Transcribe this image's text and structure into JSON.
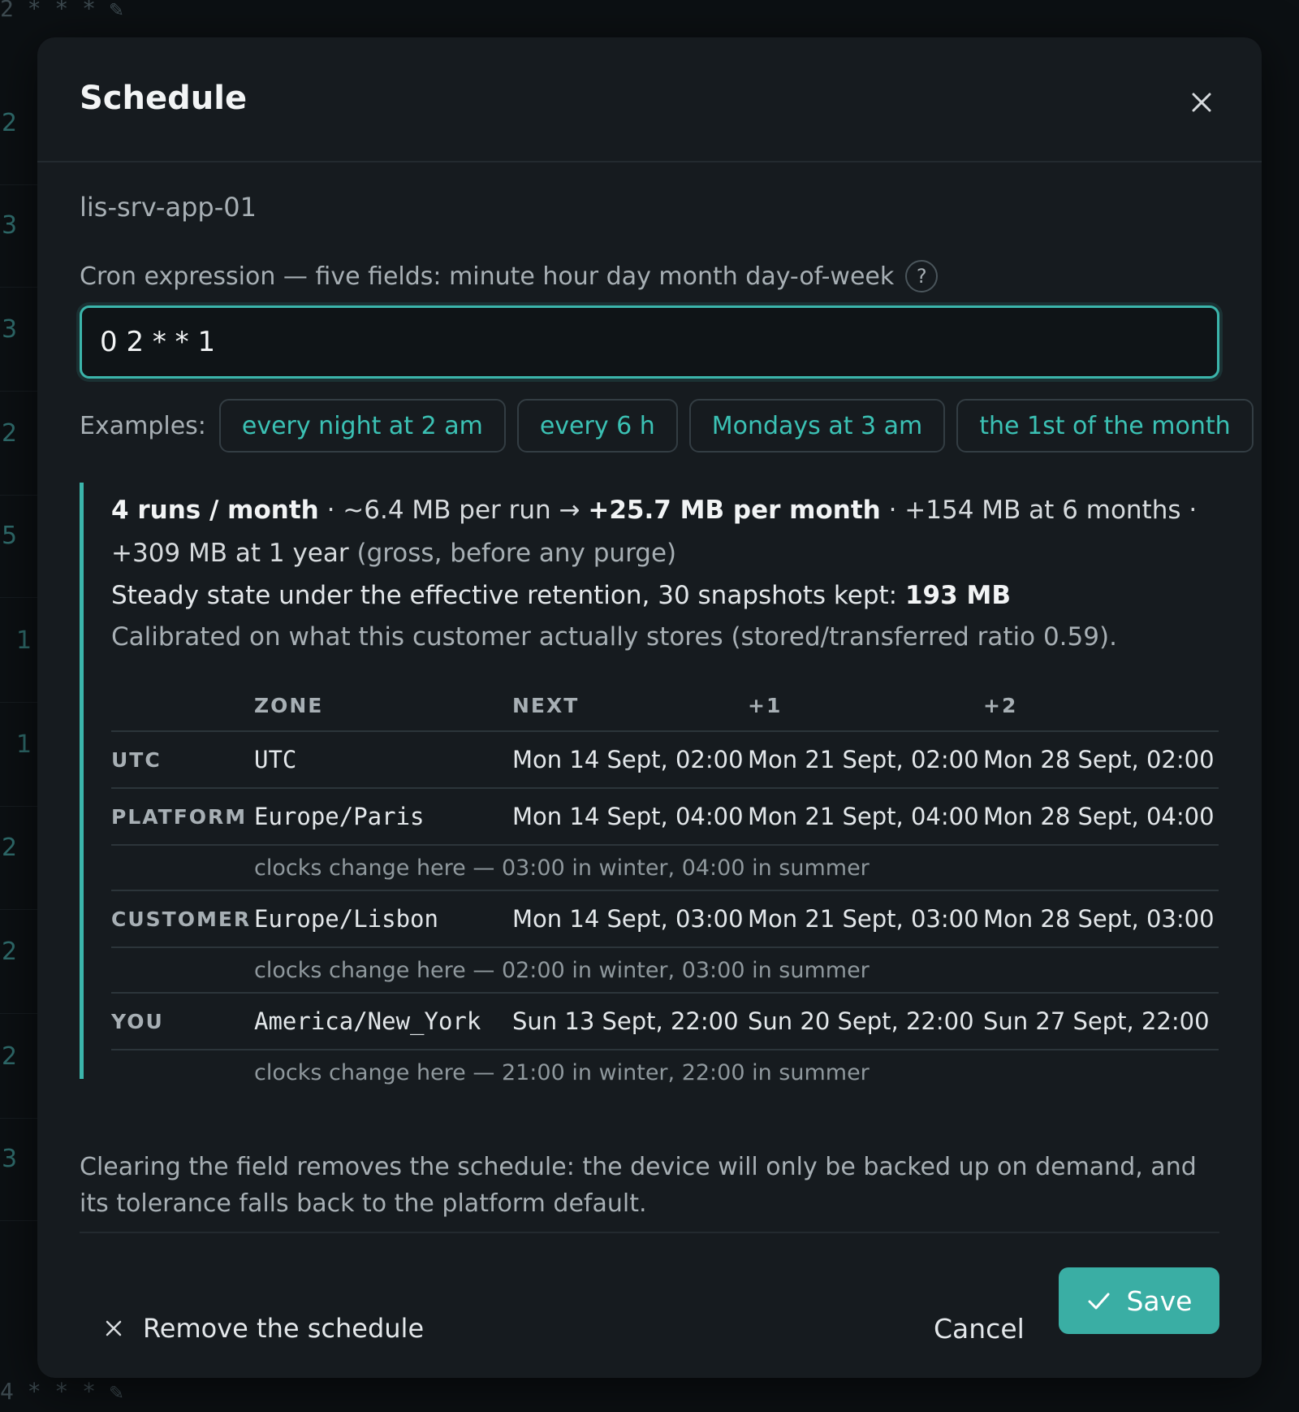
{
  "backdrop": {
    "top_text": "2 * * * ✎",
    "bottom_text": "4 * * * ✎",
    "row_numbers": [
      "2",
      "3",
      "3",
      "2",
      "5",
      "1",
      "1",
      "2",
      "2",
      "2",
      "3"
    ]
  },
  "modal": {
    "title": "Schedule",
    "close_icon": "close-icon",
    "device_name": "lis-srv-app-01",
    "cron_label": "Cron expression — five fields: minute hour day month day-of-week",
    "help_icon": "?",
    "cron_value": "0 2 * * 1",
    "examples_label": "Examples:",
    "examples": [
      "every night at 2 am",
      "every 6 h",
      "Mondays at 3 am",
      "the 1st of the month"
    ]
  },
  "estimate": {
    "runs": "4 runs / month",
    "sep1": " · ~6.4 MB per run → ",
    "per_month": "+25.7 MB per month",
    "sep2": " · +154 MB at 6 months · +309 MB at 1 year ",
    "gross_note": "(gross, before any purge)",
    "steady_prefix": "Steady state under the effective retention, 30 snapshots kept: ",
    "steady_value": "193 MB",
    "calibration": "Calibrated on what this customer actually stores (stored/transferred ratio 0.59)."
  },
  "table": {
    "headers": [
      "",
      "ZONE",
      "NEXT",
      "+1",
      "+2"
    ],
    "rows": [
      {
        "role": "UTC",
        "zone": "UTC",
        "next": "Mon 14 Sept, 02:00",
        "plus1": "Mon 21 Sept, 02:00",
        "plus2": "Mon 28 Sept, 02:00",
        "note": ""
      },
      {
        "role": "PLATFORM",
        "zone": "Europe/Paris",
        "next": "Mon 14 Sept, 04:00",
        "plus1": "Mon 21 Sept, 04:00",
        "plus2": "Mon 28 Sept, 04:00",
        "note": "clocks change here — 03:00 in winter, 04:00 in summer"
      },
      {
        "role": "CUSTOMER",
        "zone": "Europe/Lisbon",
        "next": "Mon 14 Sept, 03:00",
        "plus1": "Mon 21 Sept, 03:00",
        "plus2": "Mon 28 Sept, 03:00",
        "note": "clocks change here — 02:00 in winter, 03:00 in summer"
      },
      {
        "role": "YOU",
        "zone": "America/New_York",
        "next": "Sun 13 Sept, 22:00",
        "plus1": "Sun 20 Sept, 22:00",
        "plus2": "Sun 27 Sept, 22:00",
        "note": "clocks change here — 21:00 in winter, 22:00 in summer"
      }
    ]
  },
  "clearing_note": "Clearing the field removes the schedule: the device will only be backed up on demand, and its tolerance falls back to the platform default.",
  "footer": {
    "remove_label": "Remove the schedule",
    "cancel_label": "Cancel",
    "save_label": "Save"
  },
  "colors": {
    "accent": "#3bb5ab",
    "modal_bg": "#161b1f",
    "page_bg": "#0c1013"
  }
}
